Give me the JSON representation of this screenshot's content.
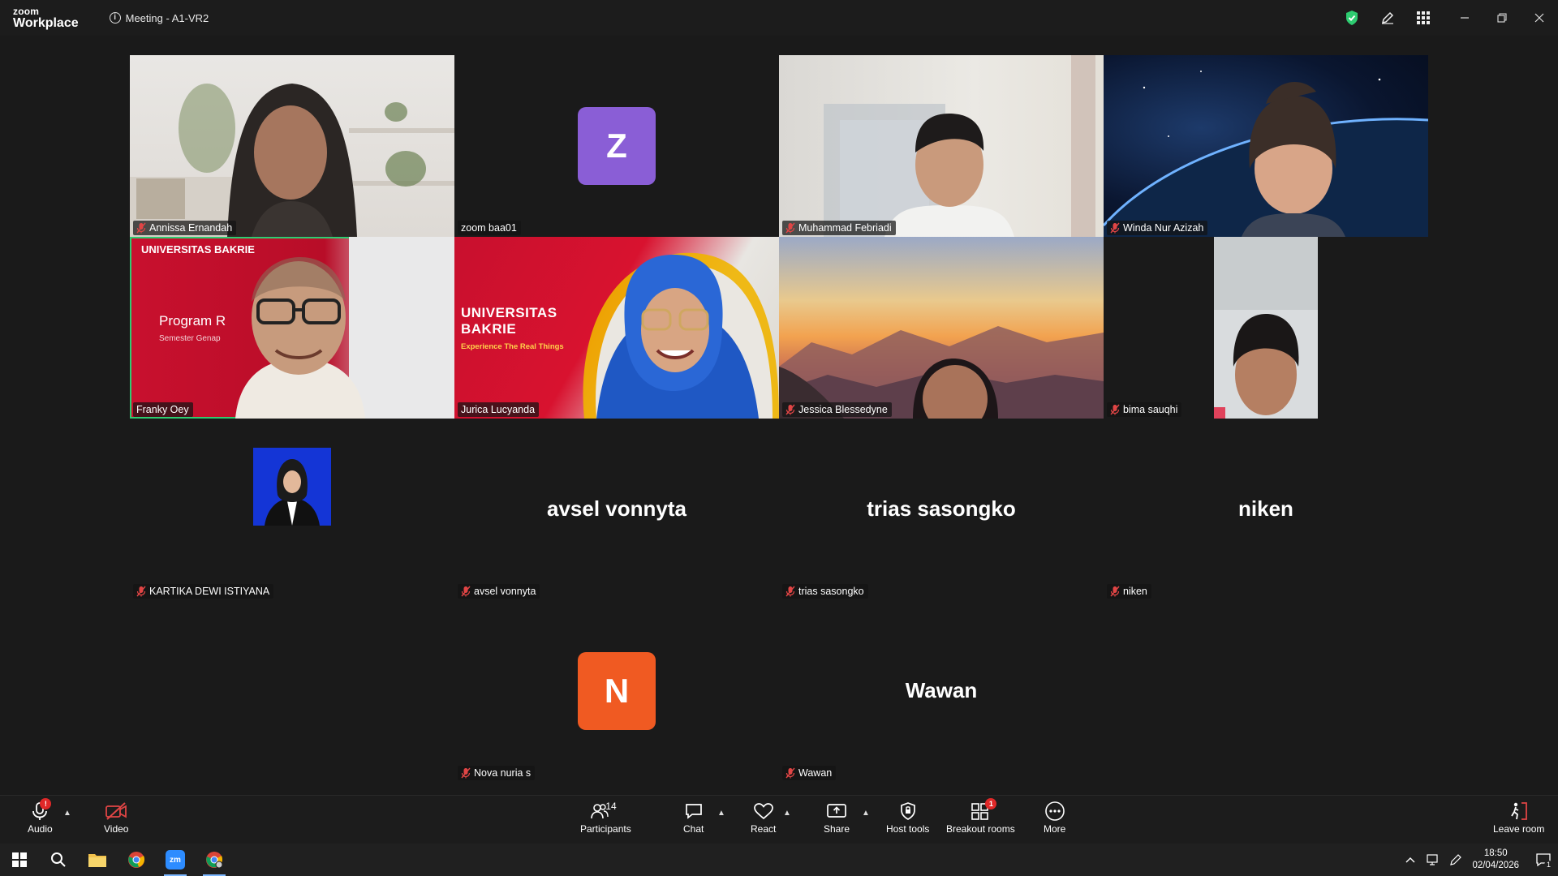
{
  "app": {
    "logo_line1": "zoom",
    "logo_line2": "Workplace",
    "meeting_title": "Meeting - A1-VR2"
  },
  "colors": {
    "speaking_border": "#2ecc71",
    "avatar_z": "#8a5ed6",
    "avatar_n": "#f05a22",
    "security_shield": "#2ecc71",
    "badge": "#e02828"
  },
  "participants": [
    {
      "name": "Annissa Ernandah",
      "muted": true,
      "video": "on"
    },
    {
      "name": "zoom baa01",
      "muted": false,
      "avatar_letter": "Z"
    },
    {
      "name": "Muhammad Febriadi",
      "muted": true,
      "video": "on"
    },
    {
      "name": "Winda Nur Azizah",
      "muted": true,
      "video": "on"
    },
    {
      "name": "Franky Oey",
      "muted": false,
      "video": "on",
      "speaking": true
    },
    {
      "name": "Jurica Lucyanda",
      "muted": false,
      "video": "on"
    },
    {
      "name": "Jessica Blessedyne",
      "muted": true,
      "video": "on"
    },
    {
      "name": "bima sauqhi",
      "muted": true,
      "video": "on"
    },
    {
      "name": "KARTIKA DEWI ISTIYANA",
      "muted": true,
      "video": "photo"
    },
    {
      "name": "avsel vonnyta",
      "muted": true,
      "display_name": "avsel vonnyta"
    },
    {
      "name": "trias sasongko",
      "muted": true,
      "display_name": "trias sasongko"
    },
    {
      "name": "niken",
      "muted": true,
      "display_name": "niken"
    },
    {
      "name": "Nova nuria s",
      "muted": true,
      "avatar_letter": "N"
    },
    {
      "name": "Wawan",
      "muted": true,
      "display_name": "Wawan"
    }
  ],
  "backgrounds": {
    "franky": {
      "title": "Program R",
      "subtitle": "Semester Genap",
      "logo": "UNIVERSITAS BAKRIE"
    },
    "jurica": {
      "title_line1": "UNIVERSITAS",
      "title_line2": "BAKRIE",
      "tagline": "Experience The Real Things"
    }
  },
  "toolbar": {
    "audio": "Audio",
    "video": "Video",
    "participants": "Participants",
    "participants_count": "14",
    "chat": "Chat",
    "react": "React",
    "share": "Share",
    "host_tools": "Host tools",
    "breakout_rooms": "Breakout rooms",
    "breakout_badge": "1",
    "more": "More",
    "leave": "Leave room",
    "audio_badge": "!"
  },
  "taskbar": {
    "time": "18:50",
    "date": "02/04/2026",
    "notification_count": "1"
  }
}
